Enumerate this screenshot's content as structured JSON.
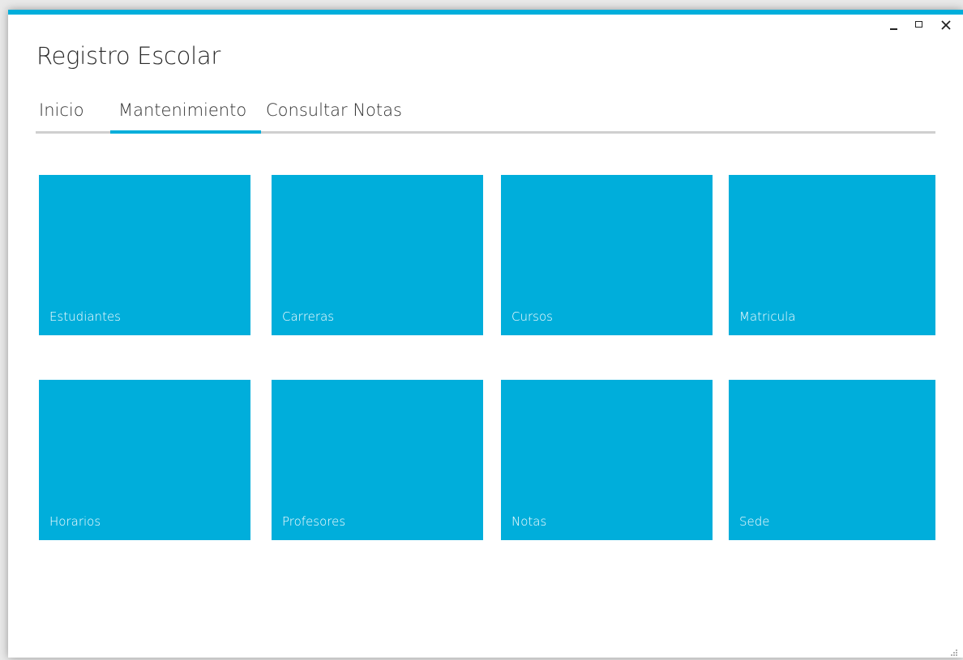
{
  "window": {
    "title": "Registro Escolar",
    "accent_color": "#00aedb",
    "controls": {
      "minimize": "minimize-icon",
      "maximize": "maximize-icon",
      "close": "close-icon"
    }
  },
  "tabs": [
    {
      "label": "Inicio",
      "active": false
    },
    {
      "label": "Mantenimiento",
      "active": true
    },
    {
      "label": "Consultar Notas",
      "active": false
    }
  ],
  "tiles": [
    {
      "label": "Estudiantes"
    },
    {
      "label": "Carreras"
    },
    {
      "label": "Cursos"
    },
    {
      "label": "Matricula"
    },
    {
      "label": "Horarios"
    },
    {
      "label": "Profesores"
    },
    {
      "label": "Notas"
    },
    {
      "label": "Sede"
    }
  ],
  "colors": {
    "tile_background": "#00aedb",
    "tile_text": "#ffffff",
    "tab_underline": "#cfcfcf"
  }
}
